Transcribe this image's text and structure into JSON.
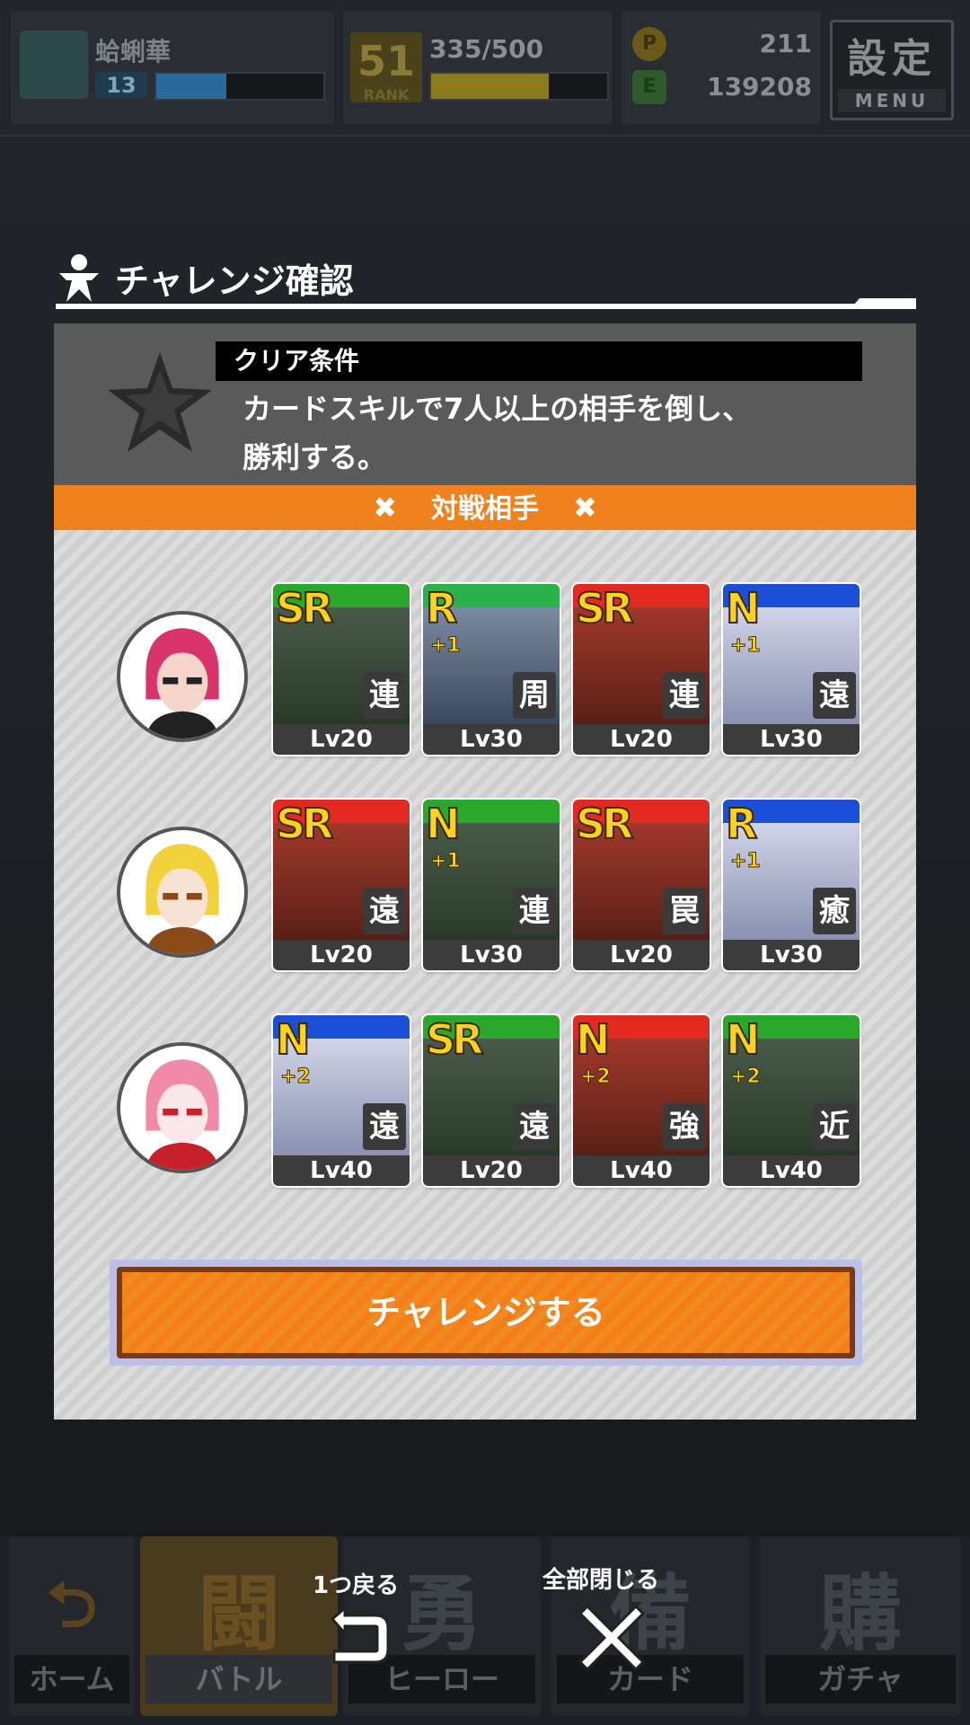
{
  "topbar": {
    "player_name": "蛤蜊華",
    "player_level": "13",
    "level_progress": 0.42,
    "rank_number": "51",
    "rank_label": "RANK",
    "xp_text": "335/500",
    "xp_progress": 0.67,
    "premium_count": "211",
    "coin_count": "139208",
    "settings_label": "設定",
    "menu_label": "MENU"
  },
  "dialog": {
    "title": "チャレンジ確認",
    "condition_label": "クリア条件",
    "condition_text_line1": "カードスキルで7人以上の相手を倒し、",
    "condition_text_line2": "勝利する。",
    "opponents_header": "対戦相手",
    "challenge_button": "チャレンジする"
  },
  "opponents": [
    {
      "cards": [
        {
          "rarity": "SR",
          "plus": "",
          "type": "連",
          "level": "Lv20",
          "header": "#2aa829"
        },
        {
          "rarity": "R",
          "plus": "+1",
          "type": "周",
          "level": "Lv30",
          "header": "#29b24a"
        },
        {
          "rarity": "SR",
          "plus": "",
          "type": "連",
          "level": "Lv20",
          "header": "#e32a22"
        },
        {
          "rarity": "N",
          "plus": "+1",
          "type": "遠",
          "level": "Lv30",
          "header": "#1c4fd8"
        }
      ]
    },
    {
      "cards": [
        {
          "rarity": "SR",
          "plus": "",
          "type": "遠",
          "level": "Lv20",
          "header": "#e32a22"
        },
        {
          "rarity": "N",
          "plus": "+1",
          "type": "連",
          "level": "Lv30",
          "header": "#2aa829"
        },
        {
          "rarity": "SR",
          "plus": "",
          "type": "罠",
          "level": "Lv20",
          "header": "#e32a22"
        },
        {
          "rarity": "R",
          "plus": "+1",
          "type": "癒",
          "level": "Lv30",
          "header": "#1c4fd8"
        }
      ]
    },
    {
      "cards": [
        {
          "rarity": "N",
          "plus": "+2",
          "type": "遠",
          "level": "Lv40",
          "header": "#1c4fd8"
        },
        {
          "rarity": "SR",
          "plus": "",
          "type": "遠",
          "level": "Lv20",
          "header": "#2aa829"
        },
        {
          "rarity": "N",
          "plus": "+2",
          "type": "強",
          "level": "Lv40",
          "header": "#e32a22"
        },
        {
          "rarity": "N",
          "plus": "+2",
          "type": "近",
          "level": "Lv40",
          "header": "#2aa829"
        }
      ]
    }
  ],
  "overlay": {
    "back_label": "1つ戻る",
    "close_all_label": "全部閉じる"
  },
  "nav": {
    "home": "ホーム",
    "battle_big": "闘",
    "battle": "バトル",
    "hero_big": "勇",
    "hero": "ヒーロー",
    "card_big": "備",
    "card": "カード",
    "gacha_big": "購",
    "gacha": "ガチャ"
  },
  "colors": {
    "accent_orange": "#f0821d",
    "overlay_dark": "#16181b"
  }
}
